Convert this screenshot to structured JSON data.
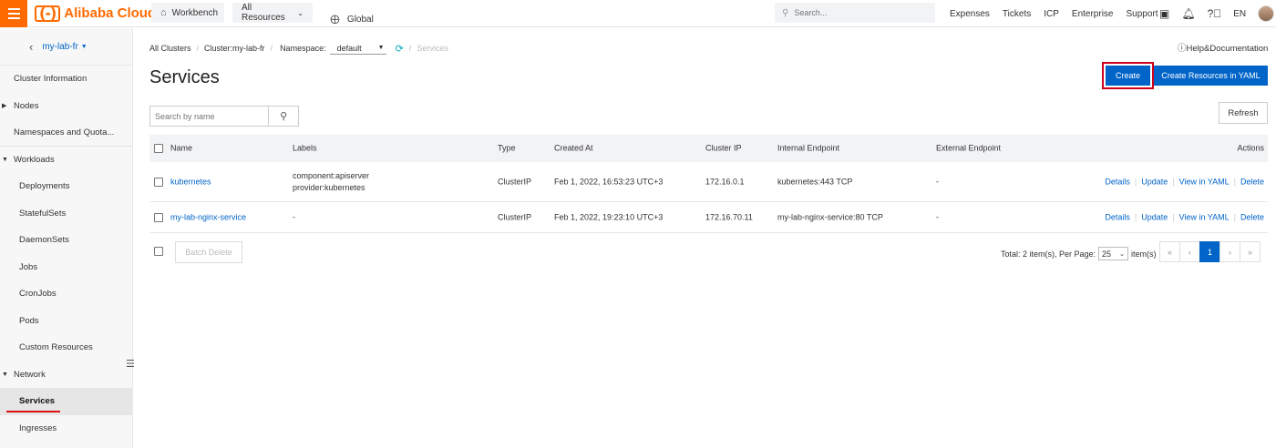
{
  "topbar": {
    "logo_mark": "(-)",
    "logo_text": "Alibaba Cloud",
    "workbench": "Workbench",
    "all_resources": "All Resources",
    "global": "Global",
    "search_placeholder": "Search...",
    "links": [
      "Expenses",
      "Tickets",
      "ICP",
      "Enterprise",
      "Support"
    ],
    "lang": "EN",
    "icons": [
      "terminal-icon",
      "bell-icon",
      "help-circle-icon"
    ]
  },
  "sidebar": {
    "cluster": "my-lab-fr",
    "items": [
      {
        "label": "Cluster Information",
        "type": "item"
      },
      {
        "label": "Nodes",
        "type": "group-collapsed"
      },
      {
        "label": "Namespaces and Quota...",
        "type": "item"
      },
      {
        "label": "Workloads",
        "type": "group-expanded"
      },
      {
        "label": "Deployments",
        "type": "sub"
      },
      {
        "label": "StatefulSets",
        "type": "sub"
      },
      {
        "label": "DaemonSets",
        "type": "sub"
      },
      {
        "label": "Jobs",
        "type": "sub"
      },
      {
        "label": "CronJobs",
        "type": "sub"
      },
      {
        "label": "Pods",
        "type": "sub"
      },
      {
        "label": "Custom Resources",
        "type": "sub"
      },
      {
        "label": "Network",
        "type": "group-expanded"
      },
      {
        "label": "Services",
        "type": "sub-active"
      },
      {
        "label": "Ingresses",
        "type": "sub"
      }
    ]
  },
  "breadcrumb": {
    "all_clusters": "All Clusters",
    "cluster": "Cluster:my-lab-fr",
    "namespace_label": "Namespace:",
    "namespace_value": "default",
    "current": "Services"
  },
  "help_link": "Help&Documentation",
  "page_title": "Services",
  "buttons": {
    "create": "Create",
    "create_yaml": "Create Resources in YAML",
    "refresh": "Refresh",
    "batch_delete": "Batch Delete"
  },
  "search": {
    "placeholder": "Search by name"
  },
  "table": {
    "headers": [
      "Name",
      "Labels",
      "Type",
      "Created At",
      "Cluster IP",
      "Internal Endpoint",
      "External Endpoint",
      "Actions"
    ],
    "rows": [
      {
        "name": "kubernetes",
        "labels": [
          "component:apiserver",
          "provider:kubernetes"
        ],
        "type": "ClusterIP",
        "created": "Feb 1, 2022, 16:53:23 UTC+3",
        "cluster_ip": "172.16.0.1",
        "internal": "kubernetes:443 TCP",
        "external": "-"
      },
      {
        "name": "my-lab-nginx-service",
        "labels": [
          "-"
        ],
        "type": "ClusterIP",
        "created": "Feb 1, 2022, 19:23:10 UTC+3",
        "cluster_ip": "172.16.70.11",
        "internal": "my-lab-nginx-service:80 TCP",
        "external": "-"
      }
    ],
    "actions": [
      "Details",
      "Update",
      "View in YAML",
      "Delete"
    ]
  },
  "pagination": {
    "total_text": "Total: 2 item(s), Per Page:",
    "per_page": "25",
    "items_suffix": "item(s)",
    "first": "«",
    "prev": "‹",
    "current": "1",
    "next": "›",
    "last": "»"
  }
}
